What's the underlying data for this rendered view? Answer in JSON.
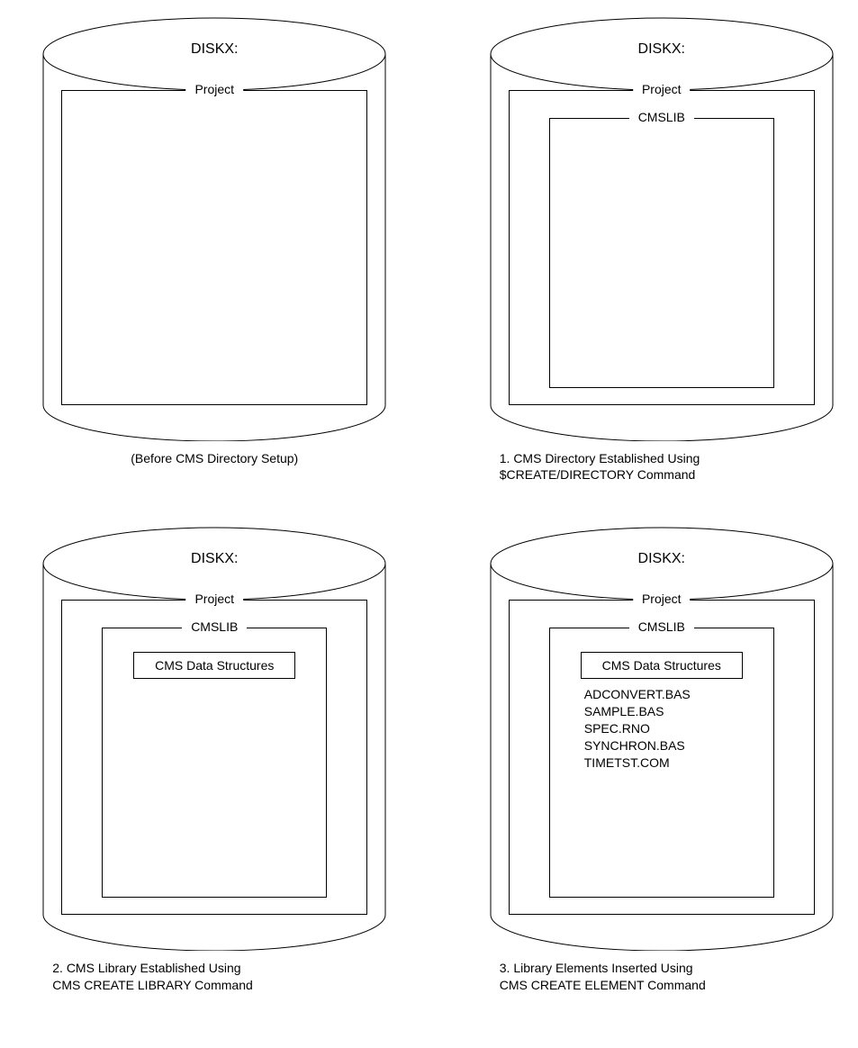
{
  "disk_label": "DISKX:",
  "project_label": "Project",
  "cmslib_label": "CMSLIB",
  "ds_label": "CMS Data Structures",
  "files": [
    "ADCONVERT.BAS",
    "SAMPLE.BAS",
    "SPEC.RNO",
    "SYNCHRON.BAS",
    "TIMETST.COM"
  ],
  "panels": {
    "p0": {
      "caption_line1": "(Before CMS Directory Setup)",
      "caption_line2": ""
    },
    "p1": {
      "caption_line1": "1. CMS Directory Established Using",
      "caption_line2": "$CREATE/DIRECTORY Command"
    },
    "p2": {
      "caption_line1": "2. CMS Library Established Using",
      "caption_line2": "CMS CREATE LIBRARY Command"
    },
    "p3": {
      "caption_line1": "3. Library Elements Inserted Using",
      "caption_line2": "CMS CREATE ELEMENT Command"
    }
  }
}
